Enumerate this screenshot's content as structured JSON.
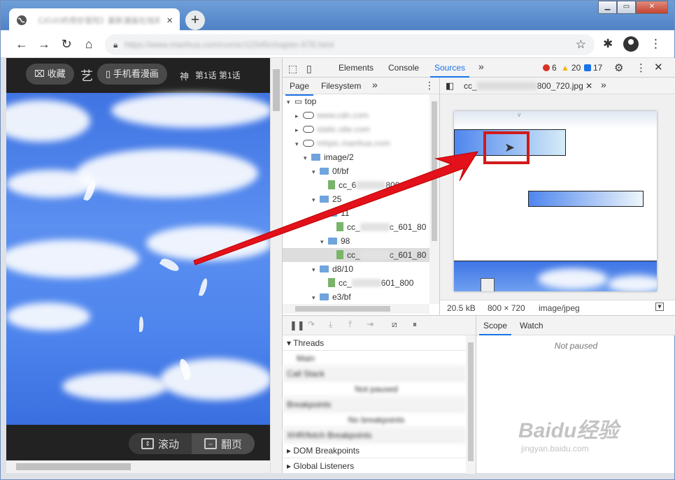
{
  "browser": {
    "tab_title": "《JOJO的奇妙冒险》最新漫画在线阅读",
    "tab_close": "×",
    "new_tab": "+",
    "url": "https://www.manhua.com/comic/12345/chapter-678.html",
    "window_buttons": [
      "▁",
      "▭",
      "✕"
    ]
  },
  "page": {
    "favorite_label": "收藏",
    "mobile_label": "手机看漫画",
    "head_text_1": "艺",
    "head_text_2": "神",
    "head_text_3": "第1话 第1话",
    "mode_scroll": "滚动",
    "mode_page": "翻页"
  },
  "devtools": {
    "tabs": [
      "Elements",
      "Console",
      "Sources"
    ],
    "more": "»",
    "errors": "6",
    "warnings": "20",
    "infos": "17",
    "navigator_tabs": [
      "Page",
      "Filesystem"
    ],
    "editor_tab": "cc_",
    "editor_tab_suffix": "800_720.jpg",
    "tree": [
      {
        "label": "top",
        "indent": 0,
        "type": "frame",
        "open": true
      },
      {
        "label": "www.cdn.com",
        "indent": 1,
        "type": "cloud",
        "open": false,
        "blur": true
      },
      {
        "label": "static.site.com",
        "indent": 1,
        "type": "cloud",
        "open": false,
        "blur": true
      },
      {
        "label": "mhpic.manhua.com",
        "indent": 1,
        "type": "cloud",
        "open": true,
        "blur": true
      },
      {
        "label": "image/2",
        "indent": 2,
        "type": "folder",
        "open": true
      },
      {
        "label": "0f/bf",
        "indent": 3,
        "type": "folder",
        "open": true
      },
      {
        "label": "cc_6",
        "indent": 4,
        "type": "file",
        "suffix": "800_"
      },
      {
        "label": "25",
        "indent": 3,
        "type": "folder",
        "open": true
      },
      {
        "label": "11",
        "indent": 4,
        "type": "folder",
        "open": true
      },
      {
        "label": "cc_",
        "indent": 5,
        "type": "file",
        "suffix": "c_601_80"
      },
      {
        "label": "98",
        "indent": 4,
        "type": "folder",
        "open": true
      },
      {
        "label": "cc_",
        "indent": 5,
        "type": "file",
        "suffix": "c_601_80",
        "selected": true
      },
      {
        "label": "d8/10",
        "indent": 3,
        "type": "folder",
        "open": true
      },
      {
        "label": "cc_",
        "indent": 4,
        "type": "file",
        "suffix": "601_800"
      },
      {
        "label": "e3/bf",
        "indent": 3,
        "type": "folder",
        "open": true
      }
    ],
    "stats": {
      "size": "20.5 kB",
      "dims": "800 × 720",
      "mime": "image/jpeg"
    },
    "threads": "Threads",
    "scope_tabs": [
      "Scope",
      "Watch"
    ],
    "not_paused": "Not paused",
    "sections": [
      "Main",
      "Call Stack",
      "Not paused",
      "Breakpoints",
      "No breakpoints",
      "XHR/fetch Breakpoints",
      "DOM Breakpoints",
      "Global Listeners"
    ]
  },
  "watermark": {
    "logo": "Baidu经验",
    "url": "jingyan.baidu.com"
  },
  "colors": {
    "accent": "#1a73e8",
    "arrow": "#e3111a",
    "highlight": "#d11a1a"
  }
}
